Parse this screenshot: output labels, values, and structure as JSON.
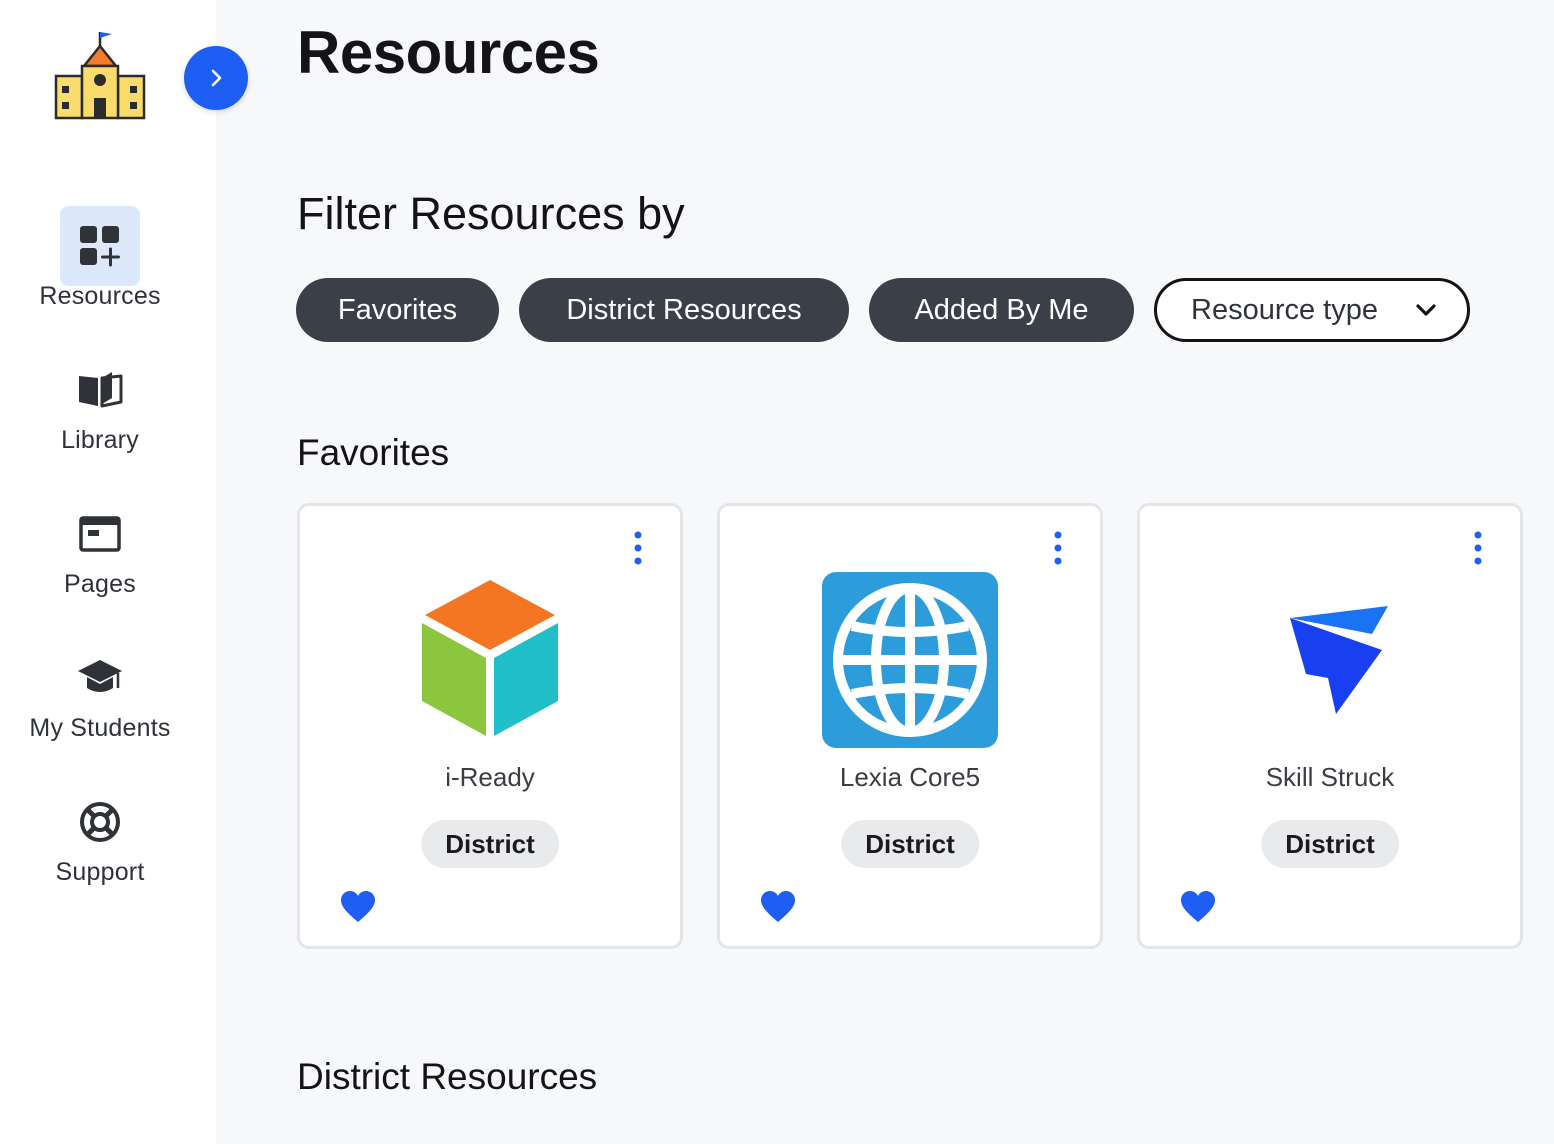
{
  "sidebar": {
    "items": [
      {
        "label": "Resources",
        "icon": "resources-icon",
        "active": true
      },
      {
        "label": "Library",
        "icon": "book-icon",
        "active": false
      },
      {
        "label": "Pages",
        "icon": "pages-icon",
        "active": false
      },
      {
        "label": "My Students",
        "icon": "graduation-cap-icon",
        "active": false
      },
      {
        "label": "Support",
        "icon": "lifebuoy-icon",
        "active": false
      }
    ]
  },
  "main": {
    "title": "Resources",
    "filter_title": "Filter Resources by",
    "filters": [
      "Favorites",
      "District Resources",
      "Added By Me"
    ],
    "resource_type": {
      "label": "Resource type"
    },
    "sections": [
      {
        "title": "Favorites",
        "cards": [
          {
            "name": "i-Ready",
            "badge": "District",
            "icon": "iready-cube-icon",
            "favorited": true
          },
          {
            "name": "Lexia Core5",
            "badge": "District",
            "icon": "globe-icon",
            "favorited": true
          },
          {
            "name": "Skill Struck",
            "badge": "District",
            "icon": "skill-struck-logo-icon",
            "favorited": true
          }
        ]
      },
      {
        "title": "District Resources"
      }
    ]
  },
  "colors": {
    "accent": "#1e5ef3",
    "chip_bg": "#3b3f47",
    "active_nav_bg": "#dde9fb",
    "heart": "#1e5ef3",
    "page_bg": "#f7f8fa"
  }
}
